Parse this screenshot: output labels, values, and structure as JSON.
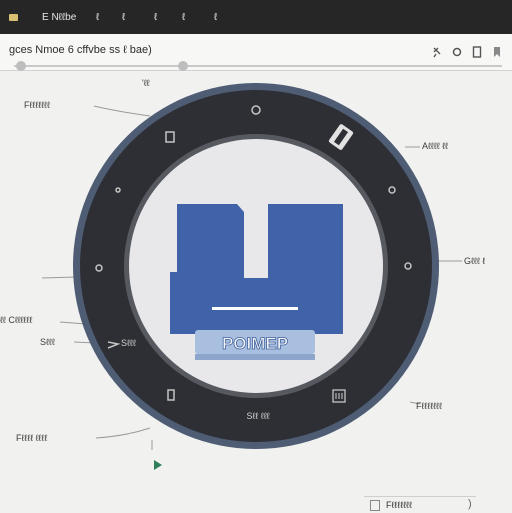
{
  "titlebar": {
    "items": [
      "E Nℓℓbe",
      "ℓ",
      "ℓ",
      "ℓ",
      "ℓ"
    ],
    "menu": [
      "ℓ",
      "ℓ",
      "ℓ"
    ]
  },
  "toolbar": {
    "path": "gces  Nmoe 6 cffvbe ss ℓ bae)"
  },
  "header_label": "'ℓℓ",
  "dial": {
    "label": "POIMEP",
    "inner_bottom": "Sℓℓ ℓℓℓ"
  },
  "callouts": {
    "left_1": "Fℓℓℓℓℓℓℓ",
    "left_2": "ℓℓ Cℓℓℓℓℓℓ",
    "left_3": "Sℓℓℓ",
    "left_4": "Fℓℓℓℓ ℓℓℓℓ",
    "right_1": "Aℓℓℓℓ ℓℓ",
    "right_2": "Gℓℓℓ ℓ",
    "right_3": "Fℓℓℓℓℓℓℓ"
  },
  "footer": {
    "label": "Fℓℓℓℓℓℓℓ"
  },
  "colors": {
    "topbar": "#262626",
    "ring": "#2d2f34",
    "rim": "#4e5c74",
    "face": "#e8e8ea",
    "accent": "#3f62a8"
  }
}
